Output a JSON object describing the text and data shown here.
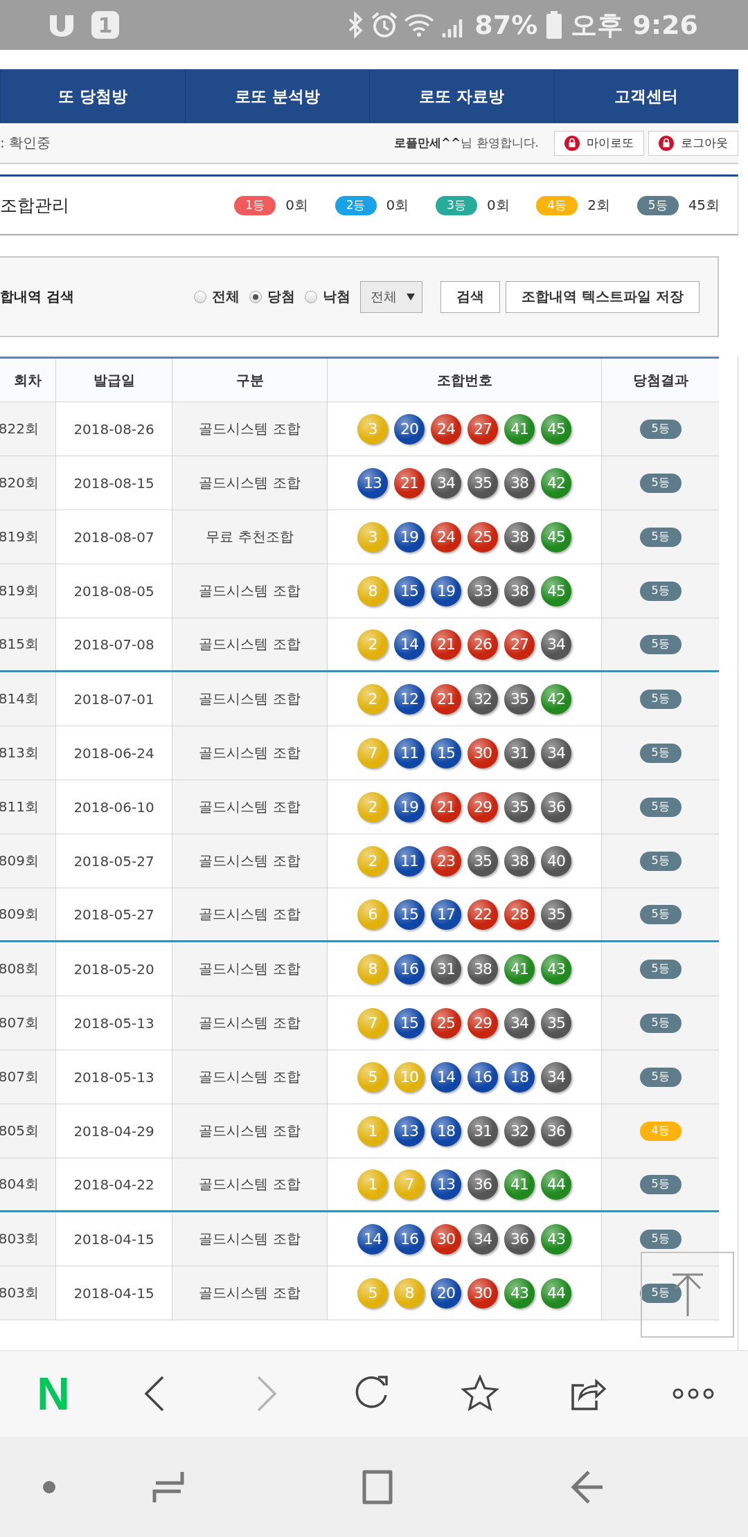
{
  "status_bar": {
    "notification": "1",
    "battery": "87%",
    "time": "오후 9:26"
  },
  "nav": {
    "items": [
      {
        "label": "또 당첨방"
      },
      {
        "label": "로또 분석방"
      },
      {
        "label": "로또 자료방"
      },
      {
        "label": "고객센터"
      }
    ]
  },
  "sub_bar": {
    "notice": ": 확인중",
    "welcome": "**로플만세^^**님 환영합니다.",
    "buttons": [
      "마이로또",
      "로그아웃"
    ]
  },
  "summary": {
    "title": "조합관리",
    "ranks": [
      {
        "label": "1등",
        "color": "#f25b5b",
        "count": "0회"
      },
      {
        "label": "2등",
        "color": "#1ba1e6",
        "count": "0회"
      },
      {
        "label": "3등",
        "color": "#27ab9b",
        "count": "0회"
      },
      {
        "label": "4등",
        "color": "#fdb30c",
        "count": "2회"
      },
      {
        "label": "5등",
        "color": "#5f7c8b",
        "count": "45회"
      }
    ]
  },
  "search": {
    "label": "합내역 검색",
    "radios": [
      {
        "label": "전체",
        "selected": false
      },
      {
        "label": "당첨",
        "selected": true
      },
      {
        "label": "낙첨",
        "selected": false
      }
    ],
    "select": "전체",
    "buttons": [
      "검색",
      "조합내역 텍스트파일 저장"
    ]
  },
  "table": {
    "columns": [
      "회차",
      "발급일",
      "구분",
      "조합번호",
      "당첨결과"
    ],
    "rows": [
      {
        "round": "822회",
        "date": "2018-08-26",
        "type": "골드시스템 조합",
        "balls": [
          {
            "number": "3",
            "color": "#e2b20c"
          },
          {
            "number": "20",
            "color": "#1047a6"
          },
          {
            "number": "24",
            "color": "#c9260f"
          },
          {
            "number": "27",
            "color": "#c9260f"
          },
          {
            "number": "41",
            "color": "#208a1f"
          },
          {
            "number": "45",
            "color": "#208a1f"
          }
        ],
        "result": {
          "label": "5등",
          "color": "#5f7c8b"
        }
      },
      {
        "round": "820회",
        "date": "2018-08-15",
        "type": "골드시스템 조합",
        "balls": [
          {
            "number": "13",
            "color": "#1047a6"
          },
          {
            "number": "21",
            "color": "#c9260f"
          },
          {
            "number": "34",
            "color": "#555555"
          },
          {
            "number": "35",
            "color": "#555555"
          },
          {
            "number": "38",
            "color": "#555555"
          },
          {
            "number": "42",
            "color": "#208a1f"
          }
        ],
        "result": {
          "label": "5등",
          "color": "#5f7c8b"
        }
      },
      {
        "round": "819회",
        "date": "2018-08-07",
        "type": "무료 추천조합",
        "balls": [
          {
            "number": "3",
            "color": "#e2b20c"
          },
          {
            "number": "19",
            "color": "#1047a6"
          },
          {
            "number": "24",
            "color": "#c9260f"
          },
          {
            "number": "25",
            "color": "#c9260f"
          },
          {
            "number": "38",
            "color": "#555555"
          },
          {
            "number": "45",
            "color": "#208a1f"
          }
        ],
        "result": {
          "label": "5등",
          "color": "#5f7c8b"
        }
      },
      {
        "round": "819회",
        "date": "2018-08-05",
        "type": "골드시스템 조합",
        "balls": [
          {
            "number": "8",
            "color": "#e2b20c"
          },
          {
            "number": "15",
            "color": "#1047a6"
          },
          {
            "number": "19",
            "color": "#1047a6"
          },
          {
            "number": "33",
            "color": "#555555"
          },
          {
            "number": "38",
            "color": "#555555"
          },
          {
            "number": "45",
            "color": "#208a1f"
          }
        ],
        "result": {
          "label": "5등",
          "color": "#5f7c8b"
        }
      },
      {
        "round": "815회",
        "date": "2018-07-08",
        "type": "골드시스템 조합",
        "balls": [
          {
            "number": "2",
            "color": "#e2b20c"
          },
          {
            "number": "14",
            "color": "#1047a6"
          },
          {
            "number": "21",
            "color": "#c9260f"
          },
          {
            "number": "26",
            "color": "#c9260f"
          },
          {
            "number": "27",
            "color": "#c9260f"
          },
          {
            "number": "34",
            "color": "#555555"
          }
        ],
        "result": {
          "label": "5등",
          "color": "#5f7c8b"
        }
      },
      {
        "round": "814회",
        "date": "2018-07-01",
        "type": "골드시스템 조합",
        "balls": [
          {
            "number": "2",
            "color": "#e2b20c"
          },
          {
            "number": "12",
            "color": "#1047a6"
          },
          {
            "number": "21",
            "color": "#c9260f"
          },
          {
            "number": "32",
            "color": "#555555"
          },
          {
            "number": "35",
            "color": "#555555"
          },
          {
            "number": "42",
            "color": "#208a1f"
          }
        ],
        "result": {
          "label": "5등",
          "color": "#5f7c8b"
        }
      },
      {
        "round": "813회",
        "date": "2018-06-24",
        "type": "골드시스템 조합",
        "balls": [
          {
            "number": "7",
            "color": "#e2b20c"
          },
          {
            "number": "11",
            "color": "#1047a6"
          },
          {
            "number": "15",
            "color": "#1047a6"
          },
          {
            "number": "30",
            "color": "#c9260f"
          },
          {
            "number": "31",
            "color": "#555555"
          },
          {
            "number": "34",
            "color": "#555555"
          }
        ],
        "result": {
          "label": "5등",
          "color": "#5f7c8b"
        }
      },
      {
        "round": "811회",
        "date": "2018-06-10",
        "type": "골드시스템 조합",
        "balls": [
          {
            "number": "2",
            "color": "#e2b20c"
          },
          {
            "number": "19",
            "color": "#1047a6"
          },
          {
            "number": "21",
            "color": "#c9260f"
          },
          {
            "number": "29",
            "color": "#c9260f"
          },
          {
            "number": "35",
            "color": "#555555"
          },
          {
            "number": "36",
            "color": "#555555"
          }
        ],
        "result": {
          "label": "5등",
          "color": "#5f7c8b"
        }
      },
      {
        "round": "809회",
        "date": "2018-05-27",
        "type": "골드시스템 조합",
        "balls": [
          {
            "number": "2",
            "color": "#e2b20c"
          },
          {
            "number": "11",
            "color": "#1047a6"
          },
          {
            "number": "23",
            "color": "#c9260f"
          },
          {
            "number": "35",
            "color": "#555555"
          },
          {
            "number": "38",
            "color": "#555555"
          },
          {
            "number": "40",
            "color": "#555555"
          }
        ],
        "result": {
          "label": "5등",
          "color": "#5f7c8b"
        }
      },
      {
        "round": "809회",
        "date": "2018-05-27",
        "type": "골드시스템 조합",
        "balls": [
          {
            "number": "6",
            "color": "#e2b20c"
          },
          {
            "number": "15",
            "color": "#1047a6"
          },
          {
            "number": "17",
            "color": "#1047a6"
          },
          {
            "number": "22",
            "color": "#c9260f"
          },
          {
            "number": "28",
            "color": "#c9260f"
          },
          {
            "number": "35",
            "color": "#555555"
          }
        ],
        "result": {
          "label": "5등",
          "color": "#5f7c8b"
        }
      },
      {
        "round": "808회",
        "date": "2018-05-20",
        "type": "골드시스템 조합",
        "balls": [
          {
            "number": "8",
            "color": "#e2b20c"
          },
          {
            "number": "16",
            "color": "#1047a6"
          },
          {
            "number": "31",
            "color": "#555555"
          },
          {
            "number": "38",
            "color": "#555555"
          },
          {
            "number": "41",
            "color": "#208a1f"
          },
          {
            "number": "43",
            "color": "#208a1f"
          }
        ],
        "result": {
          "label": "5등",
          "color": "#5f7c8b"
        }
      },
      {
        "round": "807회",
        "date": "2018-05-13",
        "type": "골드시스템 조합",
        "balls": [
          {
            "number": "7",
            "color": "#e2b20c"
          },
          {
            "number": "15",
            "color": "#1047a6"
          },
          {
            "number": "25",
            "color": "#c9260f"
          },
          {
            "number": "29",
            "color": "#c9260f"
          },
          {
            "number": "34",
            "color": "#555555"
          },
          {
            "number": "35",
            "color": "#555555"
          }
        ],
        "result": {
          "label": "5등",
          "color": "#5f7c8b"
        }
      },
      {
        "round": "807회",
        "date": "2018-05-13",
        "type": "골드시스템 조합",
        "balls": [
          {
            "number": "5",
            "color": "#e2b20c"
          },
          {
            "number": "10",
            "color": "#e2b20c"
          },
          {
            "number": "14",
            "color": "#1047a6"
          },
          {
            "number": "16",
            "color": "#1047a6"
          },
          {
            "number": "18",
            "color": "#1047a6"
          },
          {
            "number": "34",
            "color": "#555555"
          }
        ],
        "result": {
          "label": "5등",
          "color": "#5f7c8b"
        }
      },
      {
        "round": "805회",
        "date": "2018-04-29",
        "type": "골드시스템 조합",
        "balls": [
          {
            "number": "1",
            "color": "#e2b20c"
          },
          {
            "number": "13",
            "color": "#1047a6"
          },
          {
            "number": "18",
            "color": "#1047a6"
          },
          {
            "number": "31",
            "color": "#555555"
          },
          {
            "number": "32",
            "color": "#555555"
          },
          {
            "number": "36",
            "color": "#555555"
          }
        ],
        "result": {
          "label": "4등",
          "color": "#fdb30c"
        }
      },
      {
        "round": "804회",
        "date": "2018-04-22",
        "type": "골드시스템 조합",
        "balls": [
          {
            "number": "1",
            "color": "#e2b20c"
          },
          {
            "number": "7",
            "color": "#e2b20c"
          },
          {
            "number": "13",
            "color": "#1047a6"
          },
          {
            "number": "36",
            "color": "#555555"
          },
          {
            "number": "41",
            "color": "#208a1f"
          },
          {
            "number": "44",
            "color": "#208a1f"
          }
        ],
        "result": {
          "label": "5등",
          "color": "#5f7c8b"
        }
      },
      {
        "round": "803회",
        "date": "2018-04-15",
        "type": "골드시스템 조합",
        "balls": [
          {
            "number": "14",
            "color": "#1047a6"
          },
          {
            "number": "16",
            "color": "#1047a6"
          },
          {
            "number": "30",
            "color": "#c9260f"
          },
          {
            "number": "34",
            "color": "#555555"
          },
          {
            "number": "36",
            "color": "#555555"
          },
          {
            "number": "43",
            "color": "#208a1f"
          }
        ],
        "result": {
          "label": "5등",
          "color": "#5f7c8b"
        }
      },
      {
        "round": "803회",
        "date": "2018-04-15",
        "type": "골드시스템 조합",
        "balls": [
          {
            "number": "5",
            "color": "#e2b20c"
          },
          {
            "number": "8",
            "color": "#e2b20c"
          },
          {
            "number": "20",
            "color": "#1047a6"
          },
          {
            "number": "30",
            "color": "#c9260f"
          },
          {
            "number": "43",
            "color": "#208a1f"
          },
          {
            "number": "44",
            "color": "#208a1f"
          }
        ],
        "result": {
          "label": "5등",
          "color": "#5f7c8b"
        }
      }
    ]
  },
  "browser_toolbar": {
    "logo": "N",
    "buttons": [
      {
        "kind": "back",
        "disabled": false
      },
      {
        "kind": "forward",
        "disabled": true
      },
      {
        "kind": "reload",
        "disabled": false
      },
      {
        "kind": "bookmark",
        "disabled": false
      },
      {
        "kind": "share",
        "disabled": false
      },
      {
        "kind": "more",
        "disabled": false
      }
    ]
  }
}
